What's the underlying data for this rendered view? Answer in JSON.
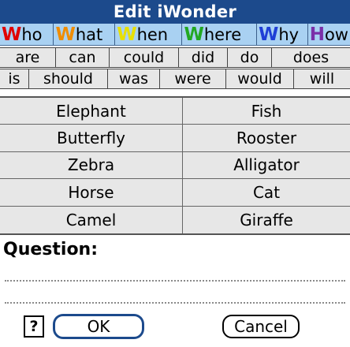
{
  "window": {
    "title": "Edit iWonder"
  },
  "question_words": [
    {
      "first": "W",
      "rest": "ho",
      "color": "#e00000"
    },
    {
      "first": "W",
      "rest": "hat",
      "color": "#f08c00"
    },
    {
      "first": "W",
      "rest": "hen",
      "color": "#e8e000"
    },
    {
      "first": "W",
      "rest": "here",
      "color": "#22a822"
    },
    {
      "first": "W",
      "rest": "hy",
      "color": "#1f3fd6"
    },
    {
      "first": "H",
      "rest": "ow",
      "color": "#7a2fa8"
    }
  ],
  "helper_row1": [
    "are",
    "can",
    "could",
    "did",
    "do",
    "does"
  ],
  "helper_row2": [
    "is",
    "should",
    "was",
    "were",
    "would",
    "will"
  ],
  "animals": [
    "Elephant",
    "Fish",
    "Butterfly",
    "Rooster",
    "Zebra",
    "Alligator",
    "Horse",
    "Cat",
    "Camel",
    "Giraffe"
  ],
  "question": {
    "label": "Question:",
    "text": ""
  },
  "buttons": {
    "help": "?",
    "ok": "OK",
    "cancel": "Cancel"
  },
  "colors": {
    "title_bar": "#1c4a8c",
    "question_row": "#a9d1f2",
    "cell_background": "#e7e7e7"
  }
}
